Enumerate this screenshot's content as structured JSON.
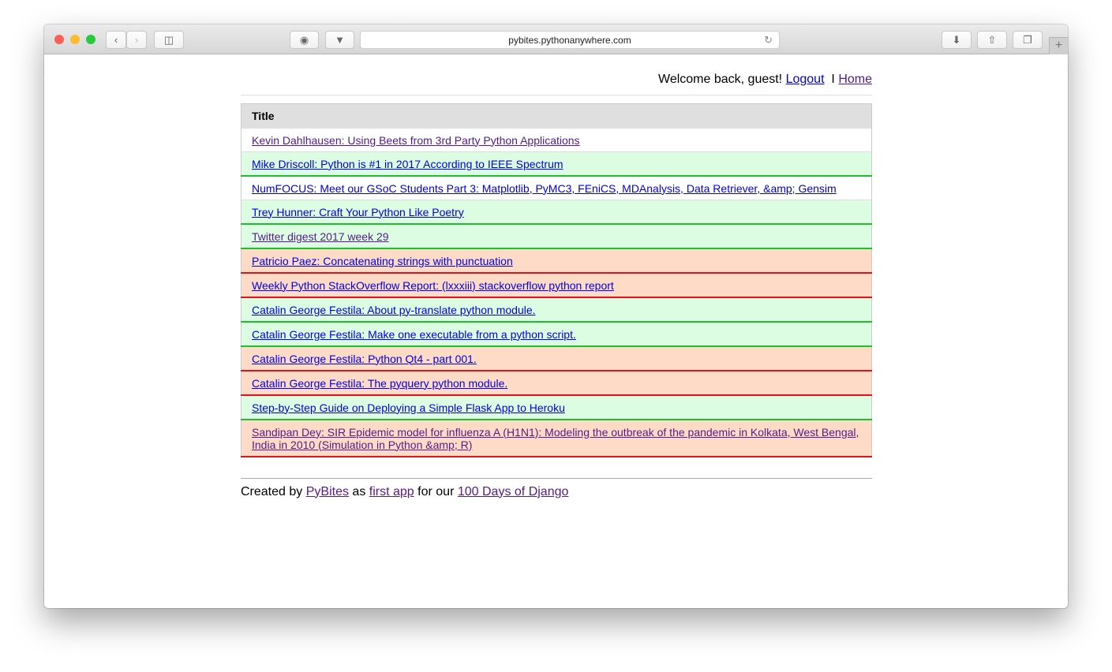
{
  "browser": {
    "url": "pybites.pythonanywhere.com"
  },
  "header": {
    "welcome": "Welcome back, guest!",
    "logout": "Logout",
    "separator": "I",
    "home": "Home"
  },
  "table": {
    "header": "Title",
    "rows": [
      {
        "title": "Kevin Dahlhausen: Using Beets from 3rd Party Python Applications",
        "status": "none",
        "visited": true
      },
      {
        "title": "Mike Driscoll: Python is #1 in 2017 According to IEEE Spectrum",
        "status": "green",
        "visited": false
      },
      {
        "title": "NumFOCUS: Meet our GSoC Students Part 3: Matplotlib, PyMC3, FEniCS, MDAnalysis, Data Retriever, &amp; Gensim",
        "status": "none",
        "visited": false
      },
      {
        "title": "Trey Hunner: Craft Your Python Like Poetry",
        "status": "green",
        "visited": false
      },
      {
        "title": "Twitter digest 2017 week 29",
        "status": "green",
        "visited": true
      },
      {
        "title": "Patricio Paez: Concatenating strings with punctuation",
        "status": "red",
        "visited": false
      },
      {
        "title": "Weekly Python StackOverflow Report: (lxxxiii) stackoverflow python report",
        "status": "red",
        "visited": false
      },
      {
        "title": "Catalin George Festila: About py-translate python module.",
        "status": "green",
        "visited": false
      },
      {
        "title": "Catalin George Festila: Make one executable from a python script.",
        "status": "green",
        "visited": false
      },
      {
        "title": "Catalin George Festila: Python Qt4 - part 001.",
        "status": "red",
        "visited": false
      },
      {
        "title": "Catalin George Festila: The pyquery python module.",
        "status": "red",
        "visited": false
      },
      {
        "title": "Step-by-Step Guide on Deploying a Simple Flask App to Heroku",
        "status": "green",
        "visited": false
      },
      {
        "title": "Sandipan Dey: SIR Epidemic model for influenza A (H1N1): Modeling the outbreak of the pandemic in Kolkata, West Bengal, India in 2010 (Simulation in Python &amp; R)",
        "status": "red",
        "visited": true
      }
    ]
  },
  "footer": {
    "created_by": "Created by",
    "pybites": "PyBites",
    "as": "as",
    "first_app": "first app",
    "for_our": "for our",
    "days": "100 Days of Django"
  }
}
